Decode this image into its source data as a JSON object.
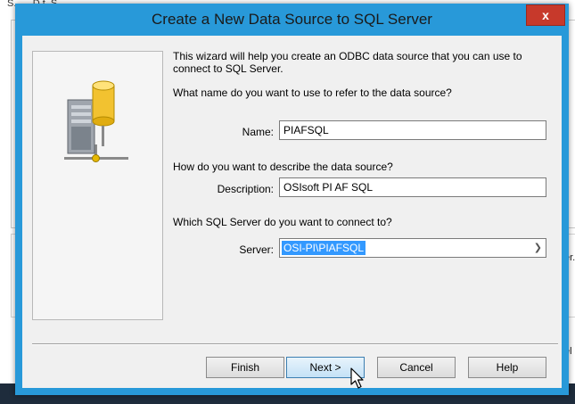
{
  "background": {
    "title_fragment": "S...... D.t. S.....",
    "right_fragment_1": "er.",
    "right_fragment_2": "el"
  },
  "dialog": {
    "title": "Create a New Data Source to SQL Server",
    "close_label": "x",
    "intro": "This wizard will help you create an ODBC data source that you can use to connect to SQL Server.",
    "name_question": "What name do you want to use to refer to the data source?",
    "name_label": "Name:",
    "name_value": "PIAFSQL",
    "description_question": "How do you want to describe the data source?",
    "description_label": "Description:",
    "description_value": "OSIsoft PI AF SQL",
    "server_question": "Which SQL Server do you want to connect to?",
    "server_label": "Server:",
    "server_value": "OSI-PI\\PIAFSQL",
    "buttons": {
      "finish": "Finish",
      "next": "Next >",
      "cancel": "Cancel",
      "help": "Help"
    }
  },
  "icons": {
    "close": "close-icon",
    "dropdown": "chevron-down-icon",
    "server": "database-server-icon",
    "cursor": "mouse-pointer-icon"
  },
  "colors": {
    "title_bar": "#2899d9",
    "close_button": "#c7392b",
    "selection": "#3399ff"
  }
}
